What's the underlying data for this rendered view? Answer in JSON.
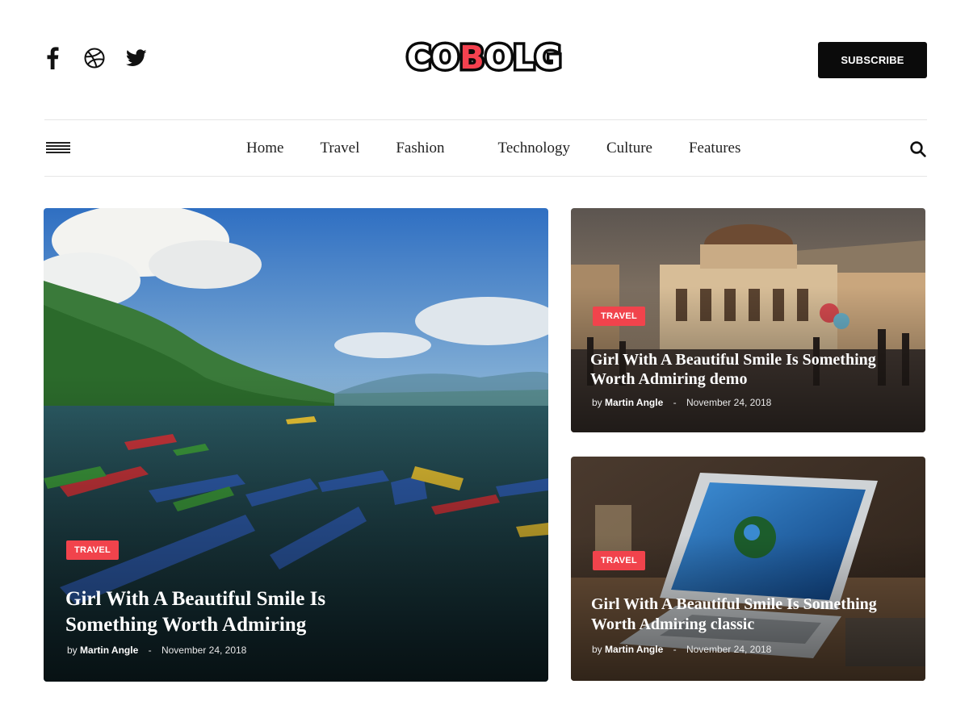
{
  "brand": {
    "logo_letters": [
      "C",
      "O",
      "B",
      "O",
      "L",
      "G"
    ],
    "accent_color": "#f4414f"
  },
  "header": {
    "social_icons": [
      "facebook-icon",
      "dribbble-icon",
      "twitter-icon"
    ],
    "subscribe_label": "SUBSCRIBE"
  },
  "nav": {
    "items": [
      {
        "label": "Home"
      },
      {
        "label": "Travel"
      },
      {
        "label": "Fashion"
      },
      {
        "label": "Technology"
      },
      {
        "label": "Culture"
      },
      {
        "label": "Features"
      }
    ],
    "menu_icon": "hamburger-icon",
    "search_icon": "search-icon"
  },
  "posts": {
    "featured": {
      "category": "TRAVEL",
      "title": "Girl With A Beautiful Smile Is Something Worth Admiring",
      "by": "by",
      "author": "Martin Angle",
      "separator": "-",
      "date": "November 24, 2018"
    },
    "side": [
      {
        "category": "TRAVEL",
        "title": "Girl With A Beautiful Smile Is Something Worth Admiring demo",
        "by": "by",
        "author": "Martin Angle",
        "separator": "-",
        "date": "November 24, 2018"
      },
      {
        "category": "TRAVEL",
        "title": "Girl With A Beautiful Smile Is Something Worth Admiring classic",
        "by": "by",
        "author": "Martin Angle",
        "separator": "-",
        "date": "November 24, 2018"
      }
    ]
  }
}
